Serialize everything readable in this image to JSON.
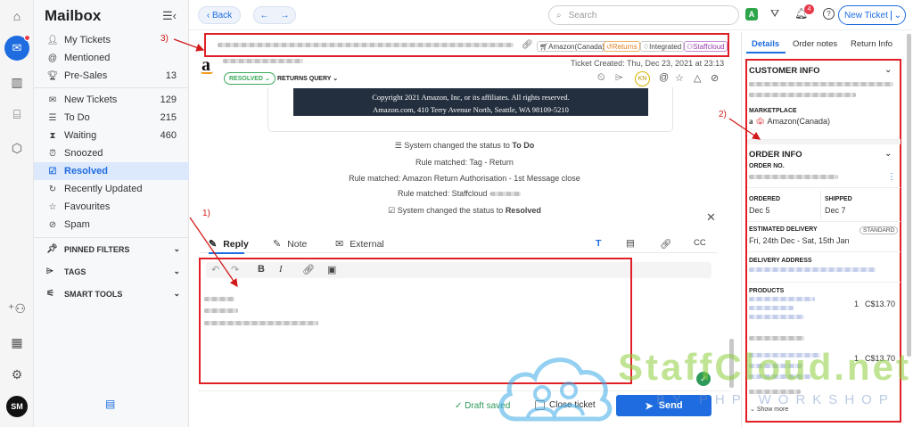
{
  "rail": {
    "avatar_initials": "SM"
  },
  "sidebar": {
    "title": "Mailbox",
    "items": [
      {
        "label": "My Tickets",
        "count": ""
      },
      {
        "label": "Mentioned",
        "count": ""
      },
      {
        "label": "Pre-Sales",
        "count": "13"
      },
      {
        "label": "New Tickets",
        "count": "129"
      },
      {
        "label": "To Do",
        "count": "215"
      },
      {
        "label": "Waiting",
        "count": "460"
      },
      {
        "label": "Snoozed",
        "count": ""
      },
      {
        "label": "Resolved",
        "count": ""
      },
      {
        "label": "Recently Updated",
        "count": ""
      },
      {
        "label": "Favourites",
        "count": ""
      },
      {
        "label": "Spam",
        "count": ""
      }
    ],
    "sections": {
      "pinned": "PINNED FILTERS",
      "tags": "TAGS",
      "smart": "SMART TOOLS"
    }
  },
  "topbar": {
    "back_label": "Back",
    "search_placeholder": "Search",
    "notification_count": "4",
    "new_ticket_label": "New Ticket"
  },
  "ticket": {
    "tags": [
      "Amazon(Canada)",
      "Returns",
      "Integrated",
      "Staffcloud"
    ],
    "created": "Ticket Created: Thu, Dec 23, 2021 at 23:13",
    "status": "RESOLVED",
    "query_type": "RETURNS QUERY",
    "assignee_initials": "KN",
    "email_footer_line1": "Copyright 2021 Amazon, Inc, or its affiliates. All rights reserved.",
    "email_footer_line2": "Amazon.com, 410 Terry Avenue North, Seattle, WA 98109-5210"
  },
  "activity": [
    {
      "prefix": "System changed the status to ",
      "bold": "To Do"
    },
    {
      "prefix": "Rule matched: Tag - Return",
      "bold": ""
    },
    {
      "prefix": "Rule matched: Amazon Return Authorisation - 1st Message close",
      "bold": ""
    },
    {
      "prefix": "Rule matched: Staffcloud - ",
      "bold": ""
    },
    {
      "prefix": "System changed the status to ",
      "bold": "Resolved"
    }
  ],
  "composer": {
    "tabs": [
      "Reply",
      "Note",
      "External"
    ],
    "cc_label": "CC",
    "draft_status": "Draft saved",
    "close_ticket_label": "Close ticket",
    "send_label": "Send"
  },
  "right_panel": {
    "tabs": [
      "Details",
      "Order notes",
      "Return Info"
    ],
    "customer_info": "CUSTOMER INFO",
    "marketplace_label": "MARKETPLACE",
    "marketplace_value": "Amazon(Canada)",
    "order_info": "ORDER INFO",
    "order_no_label": "ORDER NO.",
    "ordered_label": "ORDERED",
    "ordered_value": "Dec 5",
    "shipped_label": "SHIPPED",
    "shipped_value": "Dec 7",
    "est_delivery_label": "ESTIMATED DELIVERY",
    "est_delivery_value": "Fri, 24th Dec - Sat, 15th Jan",
    "shipping_badge": "STANDARD",
    "delivery_address_label": "DELIVERY ADDRESS",
    "products_label": "PRODUCTS",
    "products": [
      {
        "qty": "1",
        "price": "C$13.70"
      },
      {
        "qty": "1",
        "price": "C$13.70"
      }
    ],
    "show_more": "Show more"
  },
  "annotations": [
    "1)",
    "2)",
    "3)"
  ],
  "watermark": {
    "title": "StaffCloud.net",
    "subtitle": "BY PHP WORKSHOP"
  },
  "colors": {
    "accent": "#1e6ce0",
    "annotation_red": "#e01f26",
    "resolved_green": "#3cab5a",
    "watermark_green": "#8ccd3c"
  }
}
